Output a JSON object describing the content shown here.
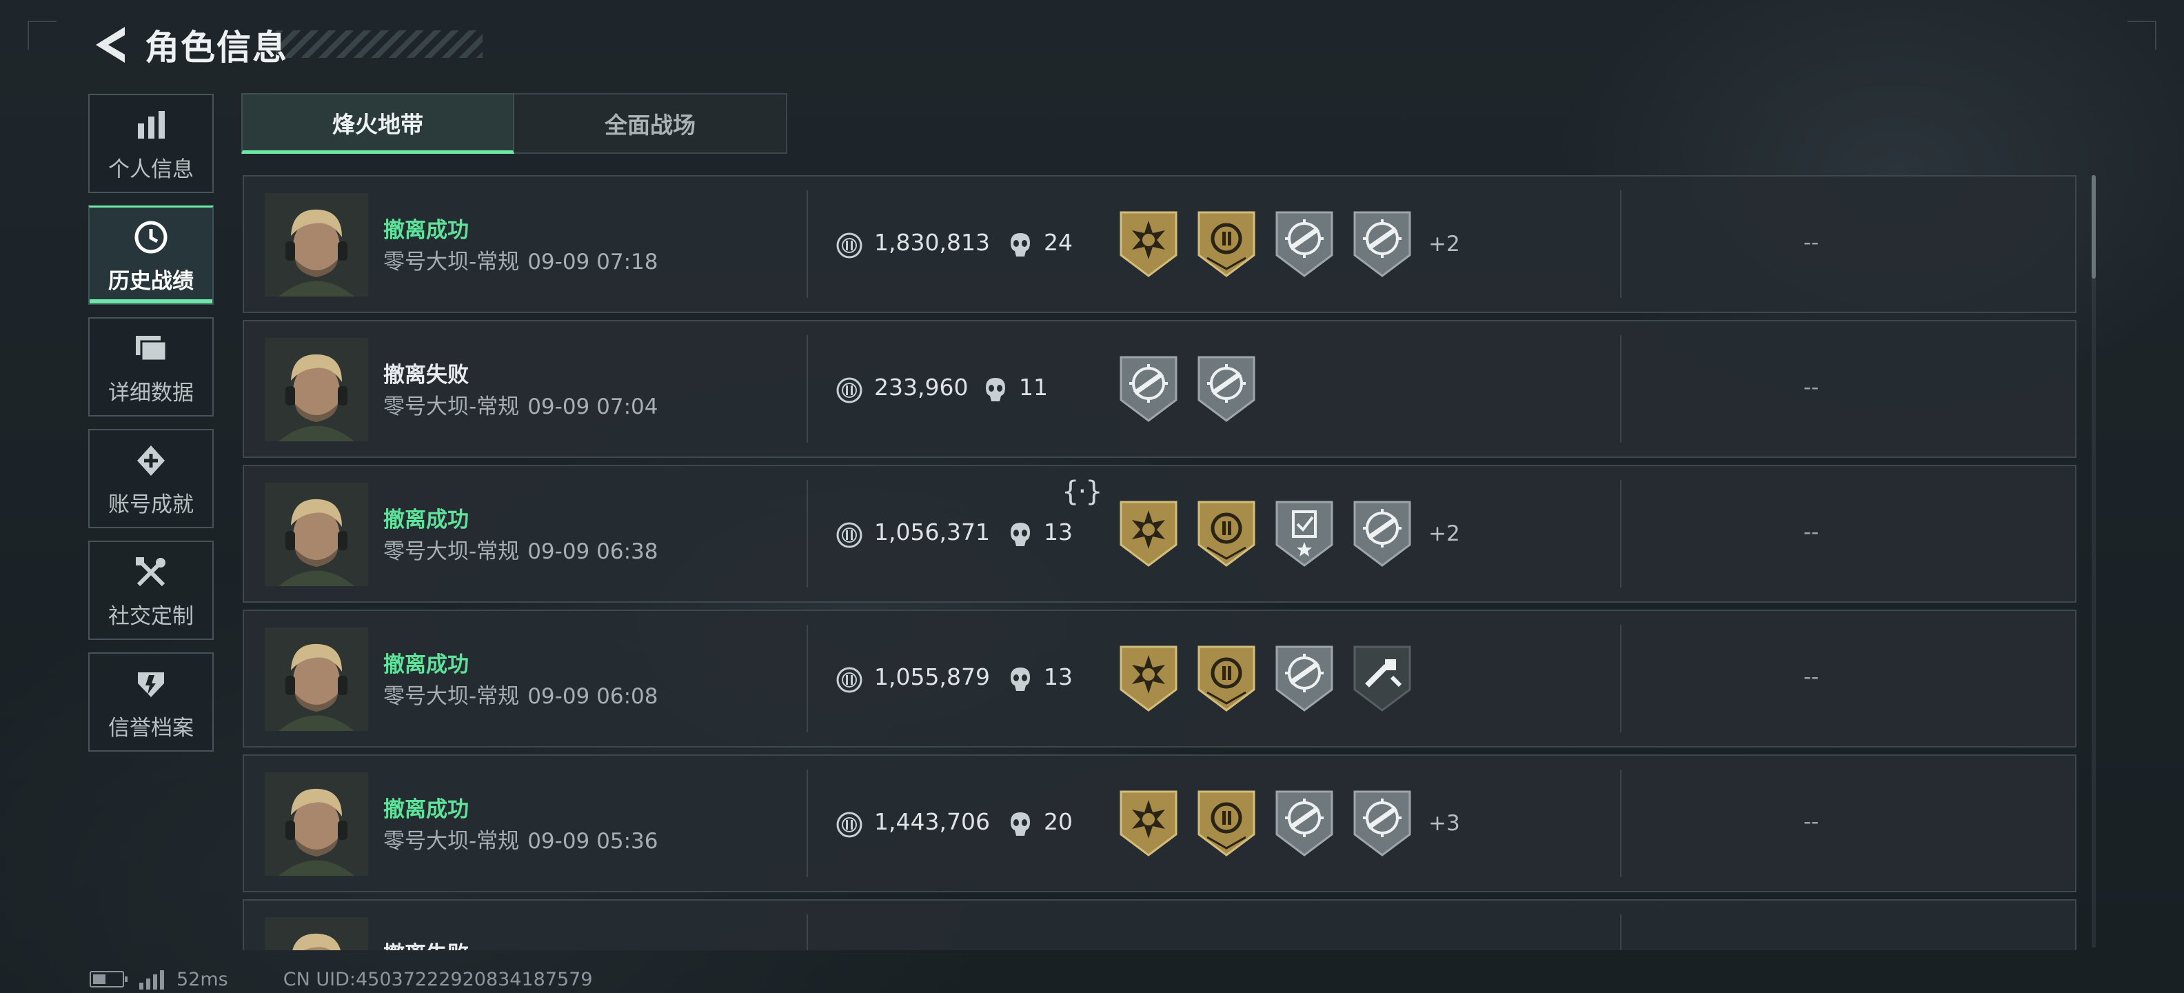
{
  "header": {
    "title": "角色信息"
  },
  "sidebar": {
    "items": [
      {
        "label": "个人信息",
        "icon": "bar-chart-icon",
        "active": false
      },
      {
        "label": "历史战绩",
        "icon": "clock-icon",
        "active": true
      },
      {
        "label": "详细数据",
        "icon": "folder-icon",
        "active": false
      },
      {
        "label": "账号成就",
        "icon": "achievement-icon",
        "active": false
      },
      {
        "label": "社交定制",
        "icon": "tools-icon",
        "active": false
      },
      {
        "label": "信誉档案",
        "icon": "credit-shield-icon",
        "active": false
      }
    ]
  },
  "tabs": [
    {
      "label": "烽火地带",
      "active": true
    },
    {
      "label": "全面战场",
      "active": false
    }
  ],
  "matches": [
    {
      "status": "撤离成功",
      "map": "零号大坝-常规",
      "time": "09-09 07:18",
      "money": "1,830,813",
      "kills": "24",
      "badges": [
        "gold-sun-badge-icon",
        "gold-coin-badge-icon",
        "silver-gun-badge-icon",
        "silver-gun-badge-icon"
      ],
      "more": "+2",
      "extra": "--"
    },
    {
      "status": "撤离失败",
      "map": "零号大坝-常规",
      "time": "09-09 07:04",
      "money": "233,960",
      "kills": "11",
      "badges": [
        "silver-gun-badge-icon",
        "silver-gun-badge-icon"
      ],
      "more": "",
      "extra": "--"
    },
    {
      "status": "撤离成功",
      "map": "零号大坝-常规",
      "time": "09-09 06:38",
      "money": "1,056,371",
      "kills": "13",
      "badges": [
        "gold-sun-badge-icon",
        "gold-coin-badge-icon",
        "silver-clipboard-badge-icon",
        "silver-gun-badge-icon"
      ],
      "more": "+2",
      "extra": "--"
    },
    {
      "status": "撤离成功",
      "map": "零号大坝-常规",
      "time": "09-09 06:08",
      "money": "1,055,879",
      "kills": "13",
      "badges": [
        "gold-sun-badge-icon",
        "gold-coin-badge-icon",
        "silver-gun-badge-icon",
        "dark-tools-badge-icon"
      ],
      "more": "",
      "extra": "--"
    },
    {
      "status": "撤离成功",
      "map": "零号大坝-常规",
      "time": "09-09 05:36",
      "money": "1,443,706",
      "kills": "20",
      "badges": [
        "gold-sun-badge-icon",
        "gold-coin-badge-icon",
        "silver-gun-badge-icon",
        "silver-gun-badge-icon"
      ],
      "more": "+3",
      "extra": "--"
    },
    {
      "status": "撤离失败",
      "map": "",
      "time": "",
      "money": "",
      "kills": "",
      "badges": [],
      "more": "",
      "extra": ""
    }
  ],
  "cursor_mark": "{·}",
  "footer": {
    "ping": "52ms",
    "uid": "CN UID:45037222920834187579"
  },
  "colors": {
    "accent": "#6ee7a8",
    "success": "#5fe39a",
    "gold": "#bda25d",
    "silver": "#8e979b"
  }
}
